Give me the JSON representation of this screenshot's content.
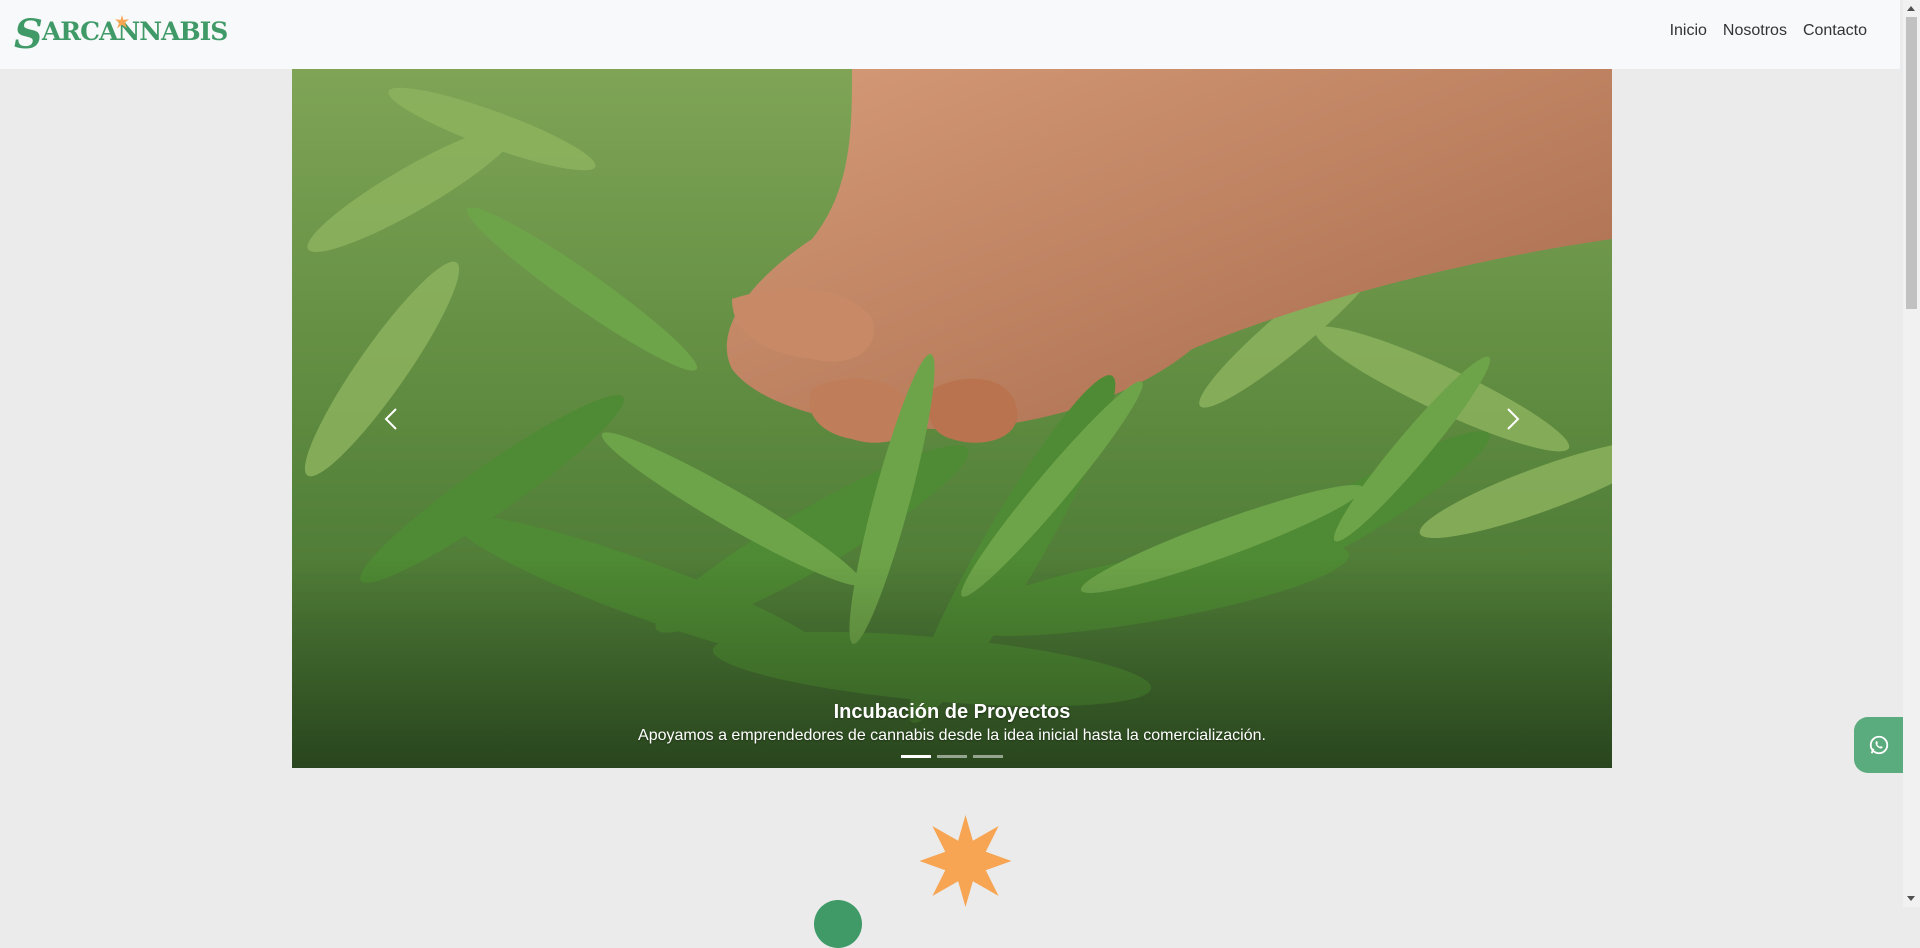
{
  "brand": {
    "logo_text_s": "S",
    "logo_text_rest": "ARCANNABIS",
    "primary_color": "#3f9a68",
    "accent_color": "#f7a552"
  },
  "nav": {
    "items": [
      {
        "label": "Inicio"
      },
      {
        "label": "Nosotros"
      },
      {
        "label": "Contacto"
      }
    ]
  },
  "carousel": {
    "active_index": 0,
    "slide_count": 3,
    "caption_title": "Incubación de Proyectos",
    "caption_text": "Apoyamos a emprendedores de cannabis desde la idea inicial hasta la comercialización.",
    "prev_icon": "chevron-left-icon",
    "next_icon": "chevron-right-icon"
  },
  "floating": {
    "whatsapp_icon": "whatsapp-icon",
    "whatsapp_color": "#5aab7d"
  }
}
